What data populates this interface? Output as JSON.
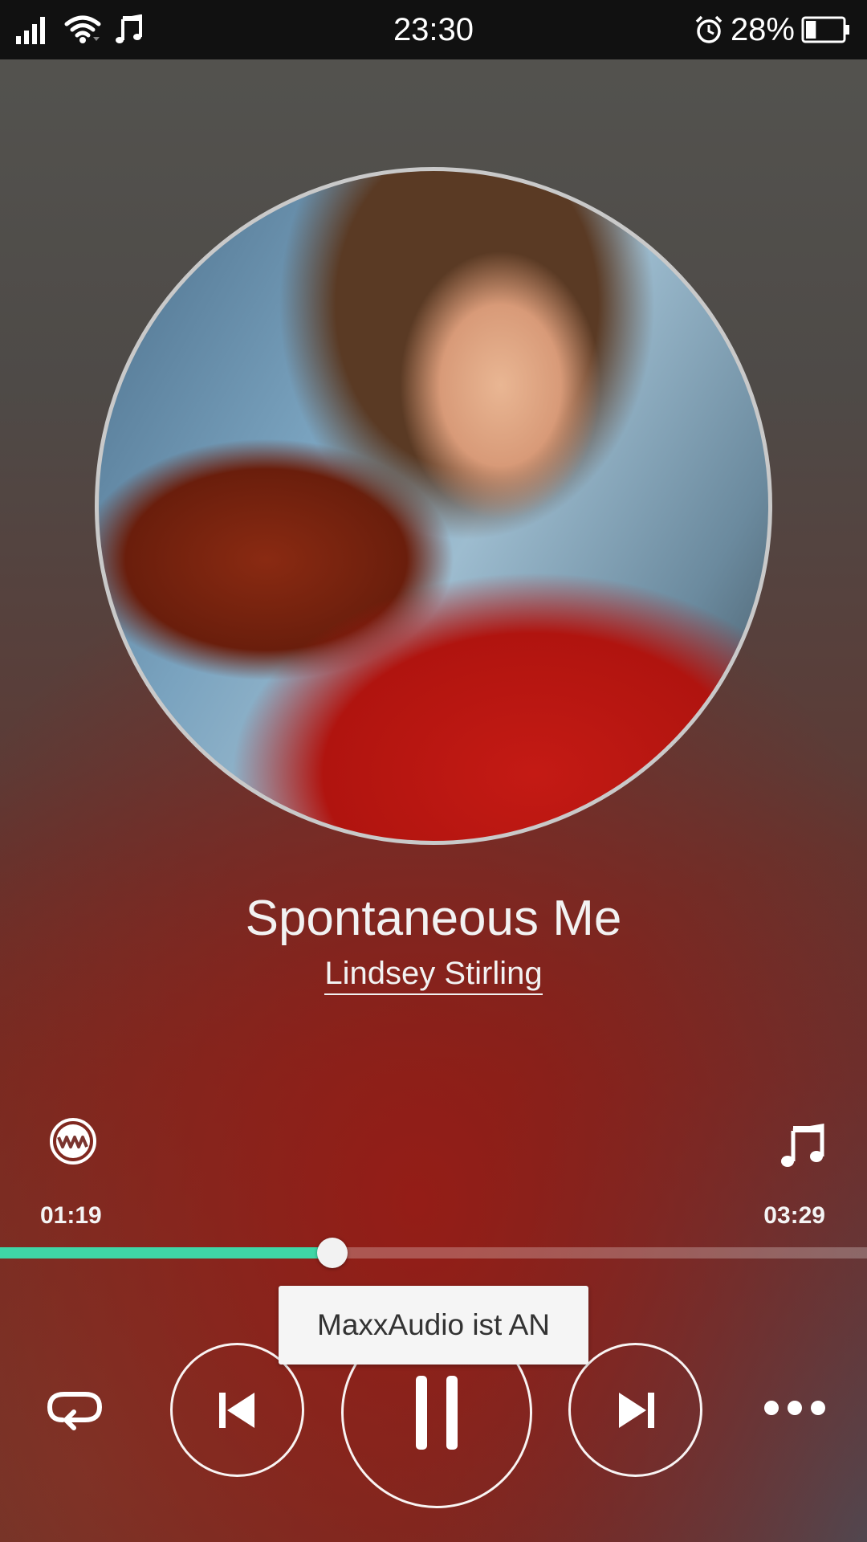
{
  "status_bar": {
    "time": "23:30",
    "battery_percent": "28%",
    "battery_level": 0.28,
    "icons": [
      "signal-icon",
      "wifi-icon",
      "music-note-icon",
      "alarm-icon",
      "battery-icon"
    ]
  },
  "song": {
    "title": "Spontaneous Me",
    "artist": "Lindsey Stirling"
  },
  "playback": {
    "elapsed": "01:19",
    "total": "03:29",
    "progress": 0.383
  },
  "toast": {
    "text": "MaxxAudio ist AN"
  },
  "controls": {
    "icons": [
      "maxxaudio-waves-icon",
      "music-note-icon",
      "repeat-icon",
      "previous-icon",
      "pause-icon",
      "next-icon",
      "more-icon"
    ]
  },
  "colors": {
    "progress_accent": "#3fd6a6",
    "status_bar_bg": "#111111"
  }
}
